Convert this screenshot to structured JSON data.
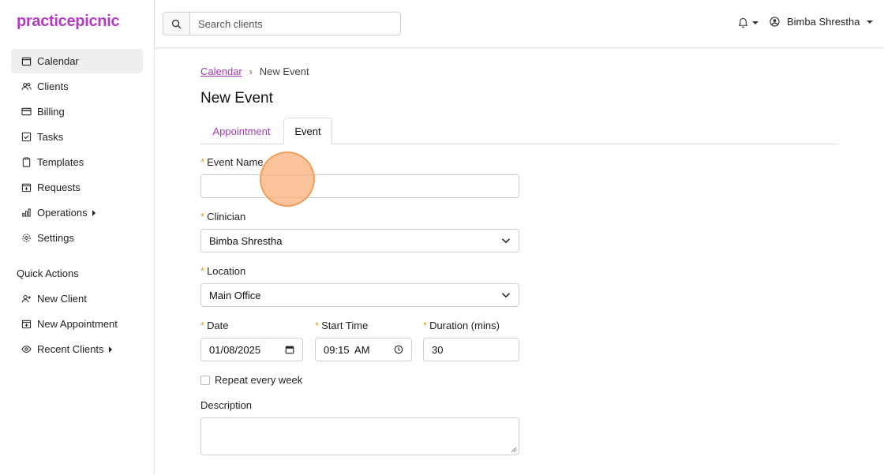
{
  "brand": {
    "logo": "practicepicnic",
    "color": "#b23cbf"
  },
  "sidebar": {
    "items": [
      {
        "label": "Calendar",
        "icon": "calendar-icon",
        "active": true
      },
      {
        "label": "Clients",
        "icon": "users-icon"
      },
      {
        "label": "Billing",
        "icon": "credit-card-icon"
      },
      {
        "label": "Tasks",
        "icon": "checkbox-icon"
      },
      {
        "label": "Templates",
        "icon": "clipboard-icon"
      },
      {
        "label": "Requests",
        "icon": "calendar-plus-icon"
      },
      {
        "label": "Operations",
        "icon": "bar-chart-icon",
        "submenu": true
      },
      {
        "label": "Settings",
        "icon": "gear-icon"
      }
    ],
    "quick_actions_title": "Quick Actions",
    "quick_actions": [
      {
        "label": "New Client",
        "icon": "user-plus-icon"
      },
      {
        "label": "New Appointment",
        "icon": "calendar-plus-icon"
      },
      {
        "label": "Recent Clients",
        "icon": "eye-icon",
        "submenu": true
      }
    ]
  },
  "topbar": {
    "search_placeholder": "Search clients",
    "user_name": "Bimba Shrestha"
  },
  "breadcrumb": {
    "parent": "Calendar",
    "separator": "›",
    "current": "New Event"
  },
  "page_title": "New Event",
  "tabs": [
    {
      "label": "Appointment"
    },
    {
      "label": "Event",
      "active": true
    }
  ],
  "form": {
    "required_marker": "*",
    "event_name": {
      "label": "Event Name",
      "value": ""
    },
    "clinician": {
      "label": "Clinician",
      "value": "Bimba Shrestha"
    },
    "location": {
      "label": "Location",
      "value": "Main Office"
    },
    "date": {
      "label": "Date",
      "value": "01/08/2025"
    },
    "start_time": {
      "label": "Start Time",
      "value": "09:15  AM"
    },
    "duration": {
      "label": "Duration (mins)",
      "value": "30"
    },
    "repeat": {
      "label": "Repeat every week",
      "checked": false
    },
    "description": {
      "label": "Description",
      "value": ""
    }
  },
  "colors": {
    "accent": "#a23bb3",
    "required": "#e0a02a",
    "cursor_highlight": "#f8a86a"
  }
}
